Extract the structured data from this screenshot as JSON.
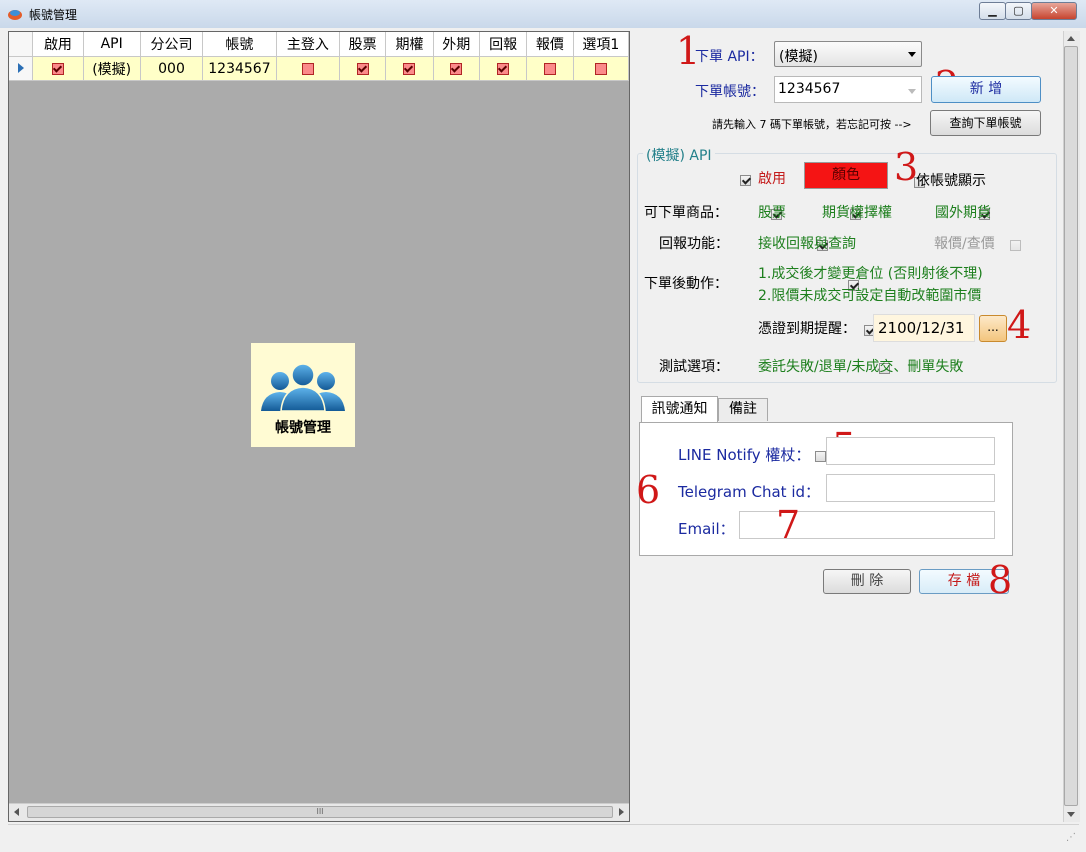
{
  "window": {
    "title": "帳號管理",
    "min": "▁",
    "max": "▢",
    "close": "✕"
  },
  "grid": {
    "headers": [
      "啟用",
      "API",
      "分公司",
      "帳號",
      "主登入",
      "股票",
      "期權",
      "外期",
      "回報",
      "報價",
      "選項1"
    ],
    "row": {
      "api": "(模擬)",
      "branch": "000",
      "account": "1234567",
      "checks": {
        "enabled": true,
        "main_login": false,
        "stock": true,
        "options": true,
        "foreign_futures": true,
        "report": true,
        "quote": false,
        "option1": false
      }
    },
    "scroll_thumb": "III"
  },
  "logo": {
    "label": "帳號管理",
    "icon": "users-icon"
  },
  "form": {
    "api_label": "下單 API：",
    "api_value": "(模擬)",
    "account_label": "下單帳號：",
    "account_value": "1234567",
    "add_button": "新 增",
    "hint": "請先輸入 7 碼下單帳號，若忘記可按 -->",
    "query_button": "查詢下單帳號",
    "group_title": "(模擬) API",
    "enable_label": "啟用",
    "color_button": "顏色",
    "show_by_account_label": "依帳號顯示",
    "tradable_label": "可下單商品：",
    "prod_stock": "股票",
    "prod_futures_options": "期貨權擇權",
    "prod_foreign_futures": "國外期貨",
    "report_label": "回報功能：",
    "report_recv": "接收回報與查詢",
    "report_quote": "報價/查價",
    "after_order_label": "下單後動作：",
    "after_order_line1": "1.成交後才變更倉位 (否則射後不理)",
    "after_order_line2": "2.限價未成交可設定自動改範圍市價",
    "cert_label": "憑證到期提醒：",
    "cert_value": "2100/12/31",
    "cert_button": "...",
    "test_label": "測試選項：",
    "test_value": "委託失敗/退單/未成交、刪單失敗",
    "tab_notify": "訊號通知",
    "tab_notes": "備註",
    "line_label": "LINE Notify 權杖：",
    "telegram_label": "Telegram Chat id：",
    "email_label": "Email：",
    "delete_button": "刪 除",
    "save_button": "存 檔",
    "checks": {
      "enable": true,
      "show_by_account": false,
      "stock": true,
      "futures_options": true,
      "foreign_futures": true,
      "report_recv": true,
      "report_quote": false,
      "after_order": true,
      "cert": true,
      "test": false,
      "line": false,
      "telegram": false,
      "email": false
    }
  },
  "annotations": [
    "1",
    "2",
    "3",
    "4",
    "5",
    "6",
    "7",
    "8"
  ],
  "colors": {
    "accent_red": "#f51414",
    "highlight_row": "#ffffc8",
    "grid_bg": "#ababab"
  }
}
